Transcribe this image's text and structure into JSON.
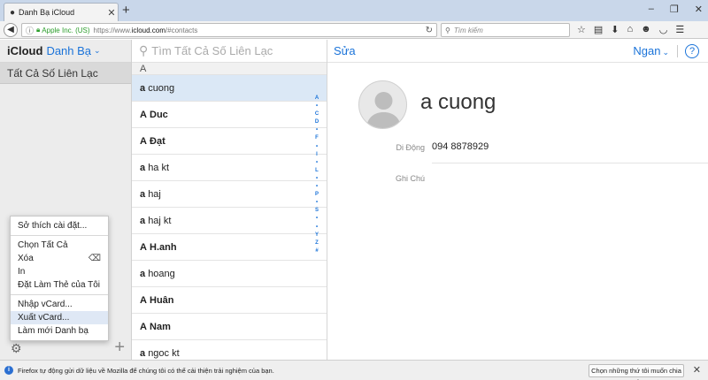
{
  "browser": {
    "tab_title": "Danh Bạ iCloud",
    "url_org": "Apple Inc. (US)",
    "url_prefix": "https://www.",
    "url_host": "icloud.com",
    "url_path": "/#contacts",
    "search_placeholder": "Tìm kiếm"
  },
  "sidebar": {
    "brand": "iCloud",
    "app_name": "Danh Bạ",
    "group": "Tất Cả Số Liên Lạc"
  },
  "menu": {
    "items": [
      {
        "label": "Sở thích cài đặt..."
      },
      {
        "label": "Chọn Tất Cả"
      },
      {
        "label": "Xóa",
        "shortcut": "⌫"
      },
      {
        "label": "In"
      },
      {
        "label": "Đặt Làm Thẻ của Tôi"
      },
      {
        "label": "Nhập vCard..."
      },
      {
        "label": "Xuất vCard..."
      },
      {
        "label": "Làm mới Danh bạ"
      }
    ]
  },
  "list": {
    "search_placeholder": "Tìm Tất Cả Số Liên Lạc",
    "section": "A",
    "contacts": [
      {
        "first": "a",
        "last": "cuong"
      },
      {
        "first": "A",
        "last": "Duc"
      },
      {
        "first": "A",
        "last": "Đạt"
      },
      {
        "first": "a",
        "last": "ha kt"
      },
      {
        "first": "a",
        "last": "haj"
      },
      {
        "first": "a",
        "last": "haj kt"
      },
      {
        "first": "A",
        "last": "H.anh"
      },
      {
        "first": "a",
        "last": "hoang"
      },
      {
        "first": "A",
        "last": "Huân"
      },
      {
        "first": "A",
        "last": "Nam"
      },
      {
        "first": "a",
        "last": "ngoc kt"
      }
    ],
    "index": [
      "A",
      "•",
      "C",
      "D",
      "•",
      "F",
      "•",
      "I",
      "•",
      "L",
      "•",
      "•",
      "P",
      "•",
      "S",
      "•",
      "•",
      "Y",
      "Z",
      "#"
    ]
  },
  "detail": {
    "edit_label": "Sửa",
    "sort_label": "Ngan",
    "help_label": "?",
    "name": "a cuong",
    "phone_label": "Di Động",
    "phone_value": "094 8878929",
    "note_label": "Ghi Chú"
  },
  "statusbar": {
    "message": "Firefox tự động gửi dữ liệu về Mozilla để chúng tôi có thể cải thiện trải nghiệm của bạn.",
    "button": "Chọn những thứ tôi muốn chia sẻ"
  }
}
